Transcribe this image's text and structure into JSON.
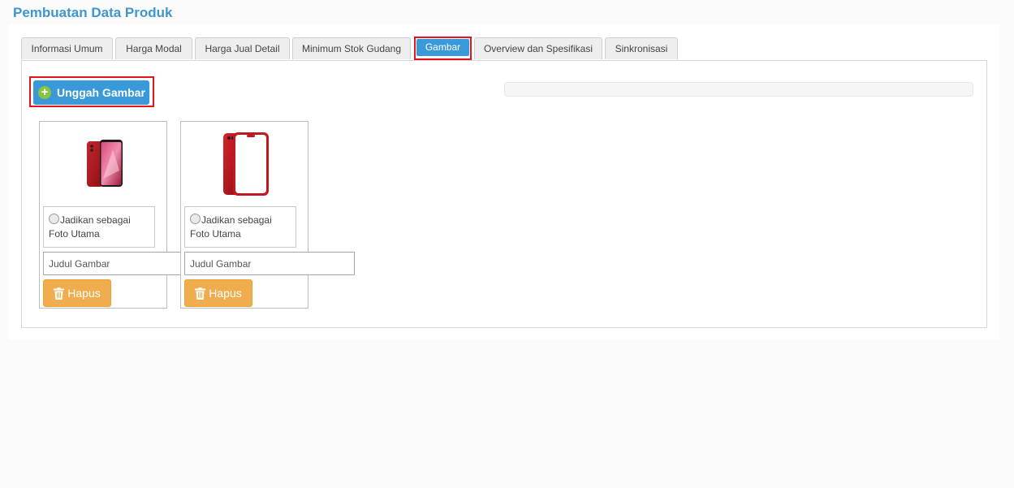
{
  "page": {
    "title": "Pembuatan Data Produk"
  },
  "tabs": [
    {
      "label": "Informasi Umum"
    },
    {
      "label": "Harga Modal"
    },
    {
      "label": "Harga Jual Detail"
    },
    {
      "label": "Minimum Stok Gudang"
    },
    {
      "label": "Gambar",
      "active": true
    },
    {
      "label": "Overview dan Spesifikasi"
    },
    {
      "label": "Sinkronisasi"
    }
  ],
  "upload": {
    "label": "Unggah Gambar",
    "icon": "plus-circle-icon",
    "progress": 0
  },
  "images": [
    {
      "radio_line1": "Jadikan sebagai",
      "radio_line2": "Foto Utama",
      "title_placeholder": "Judul Gambar",
      "title_value": "",
      "delete_label": "Hapus"
    },
    {
      "radio_line1": "Jadikan sebagai",
      "radio_line2": "Foto Utama",
      "title_placeholder": "Judul Gambar",
      "title_value": "",
      "delete_label": "Hapus"
    }
  ],
  "colors": {
    "accent": "#3a9ad9",
    "highlight": "#e3141c",
    "warning": "#f0ad4e",
    "add_icon": "#8bc43f"
  }
}
